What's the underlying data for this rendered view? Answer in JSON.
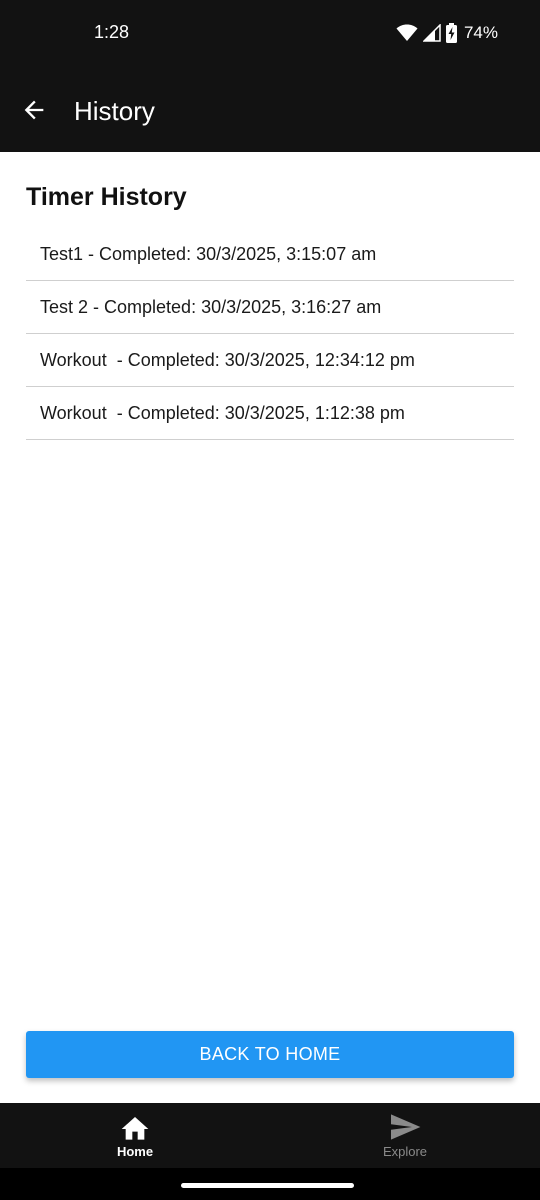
{
  "status_bar": {
    "time": "1:28",
    "battery": "74%",
    "icons": [
      "wifi-icon",
      "cell-signal-icon",
      "battery-charging-icon"
    ]
  },
  "app_bar": {
    "title": "History",
    "back_icon": "arrow-back-icon"
  },
  "content": {
    "section_title": "Timer History",
    "items": [
      "Test1 - Completed: 30/3/2025, 3:15:07 am",
      "Test 2 - Completed: 30/3/2025, 3:16:27 am",
      "Workout  - Completed: 30/3/2025, 12:34:12 pm",
      "Workout  - Completed: 30/3/2025, 1:12:38 pm"
    ]
  },
  "home_button": {
    "label": "BACK TO HOME"
  },
  "bottom_nav": {
    "items": [
      {
        "label": "Home",
        "icon": "home-icon",
        "active": true
      },
      {
        "label": "Explore",
        "icon": "send-icon",
        "active": false
      }
    ]
  },
  "colors": {
    "bar_background": "#121212",
    "accent": "#2196f3",
    "divider": "#cfcfcf",
    "inactive": "#8a8a8a"
  }
}
